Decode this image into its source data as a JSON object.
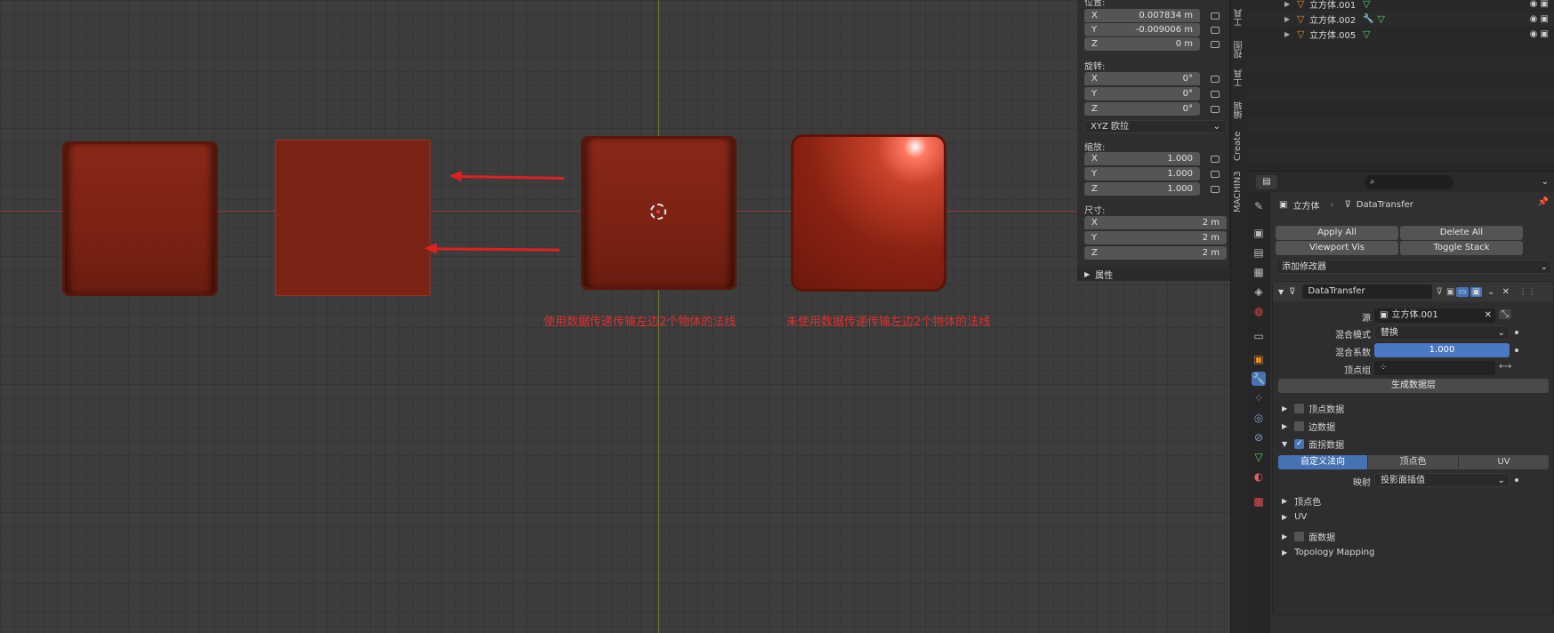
{
  "viewport": {
    "caption_left": "使用数据传递传输左边2个物体的法线",
    "caption_right": "未使用数据传递传输左边2个物体的法线"
  },
  "npanel": {
    "location_label": "位置:",
    "location": [
      {
        "axis": "X",
        "value": "0.007834 m"
      },
      {
        "axis": "Y",
        "value": "-0.009006 m"
      },
      {
        "axis": "Z",
        "value": "0 m"
      }
    ],
    "rotation_label": "旋转:",
    "rotation": [
      {
        "axis": "X",
        "value": "0°"
      },
      {
        "axis": "Y",
        "value": "0°"
      },
      {
        "axis": "Z",
        "value": "0°"
      }
    ],
    "rotation_mode": "XYZ 欧拉",
    "scale_label": "缩放:",
    "scale": [
      {
        "axis": "X",
        "value": "1.000"
      },
      {
        "axis": "Y",
        "value": "1.000"
      },
      {
        "axis": "Z",
        "value": "1.000"
      }
    ],
    "dimensions_label": "尺寸:",
    "dimensions": [
      {
        "axis": "X",
        "value": "2 m"
      },
      {
        "axis": "Y",
        "value": "2 m"
      },
      {
        "axis": "Z",
        "value": "2 m"
      }
    ],
    "properties_section": "属性"
  },
  "side_tabs": [
    "工具",
    "视图",
    "工具",
    "编辑",
    "Create",
    "MACHIN3"
  ],
  "outliner": {
    "rows": [
      "立方体.001",
      "立方体.002",
      "立方体.005"
    ]
  },
  "properties": {
    "breadcrumb_object": "立方体",
    "breadcrumb_modifier": "DataTransfer",
    "apply_all": "Apply All",
    "delete_all": "Delete All",
    "viewport_vis": "Viewport Vis",
    "toggle_stack": "Toggle Stack",
    "add_modifier": "添加修改器",
    "modifier_name": "DataTransfer",
    "source_label": "源",
    "source_value": "立方体.001",
    "mix_mode_label": "混合模式",
    "mix_mode_value": "替换",
    "mix_factor_label": "混合系数",
    "mix_factor_value": "1.000",
    "vertex_group_label": "顶点组",
    "generate_layers": "生成数据层",
    "vertex_data": "顶点数据",
    "edge_data": "边数据",
    "face_corner_data": "面拐数据",
    "tab_custom_normals": "自定义法向",
    "tab_vertex_color": "顶点色",
    "tab_uv": "UV",
    "mapping_label": "映射",
    "mapping_value": "投影面插值",
    "sub_vertex_color": "顶点色",
    "sub_uv": "UV",
    "face_data": "面数据",
    "topology_mapping": "Topology Mapping"
  }
}
